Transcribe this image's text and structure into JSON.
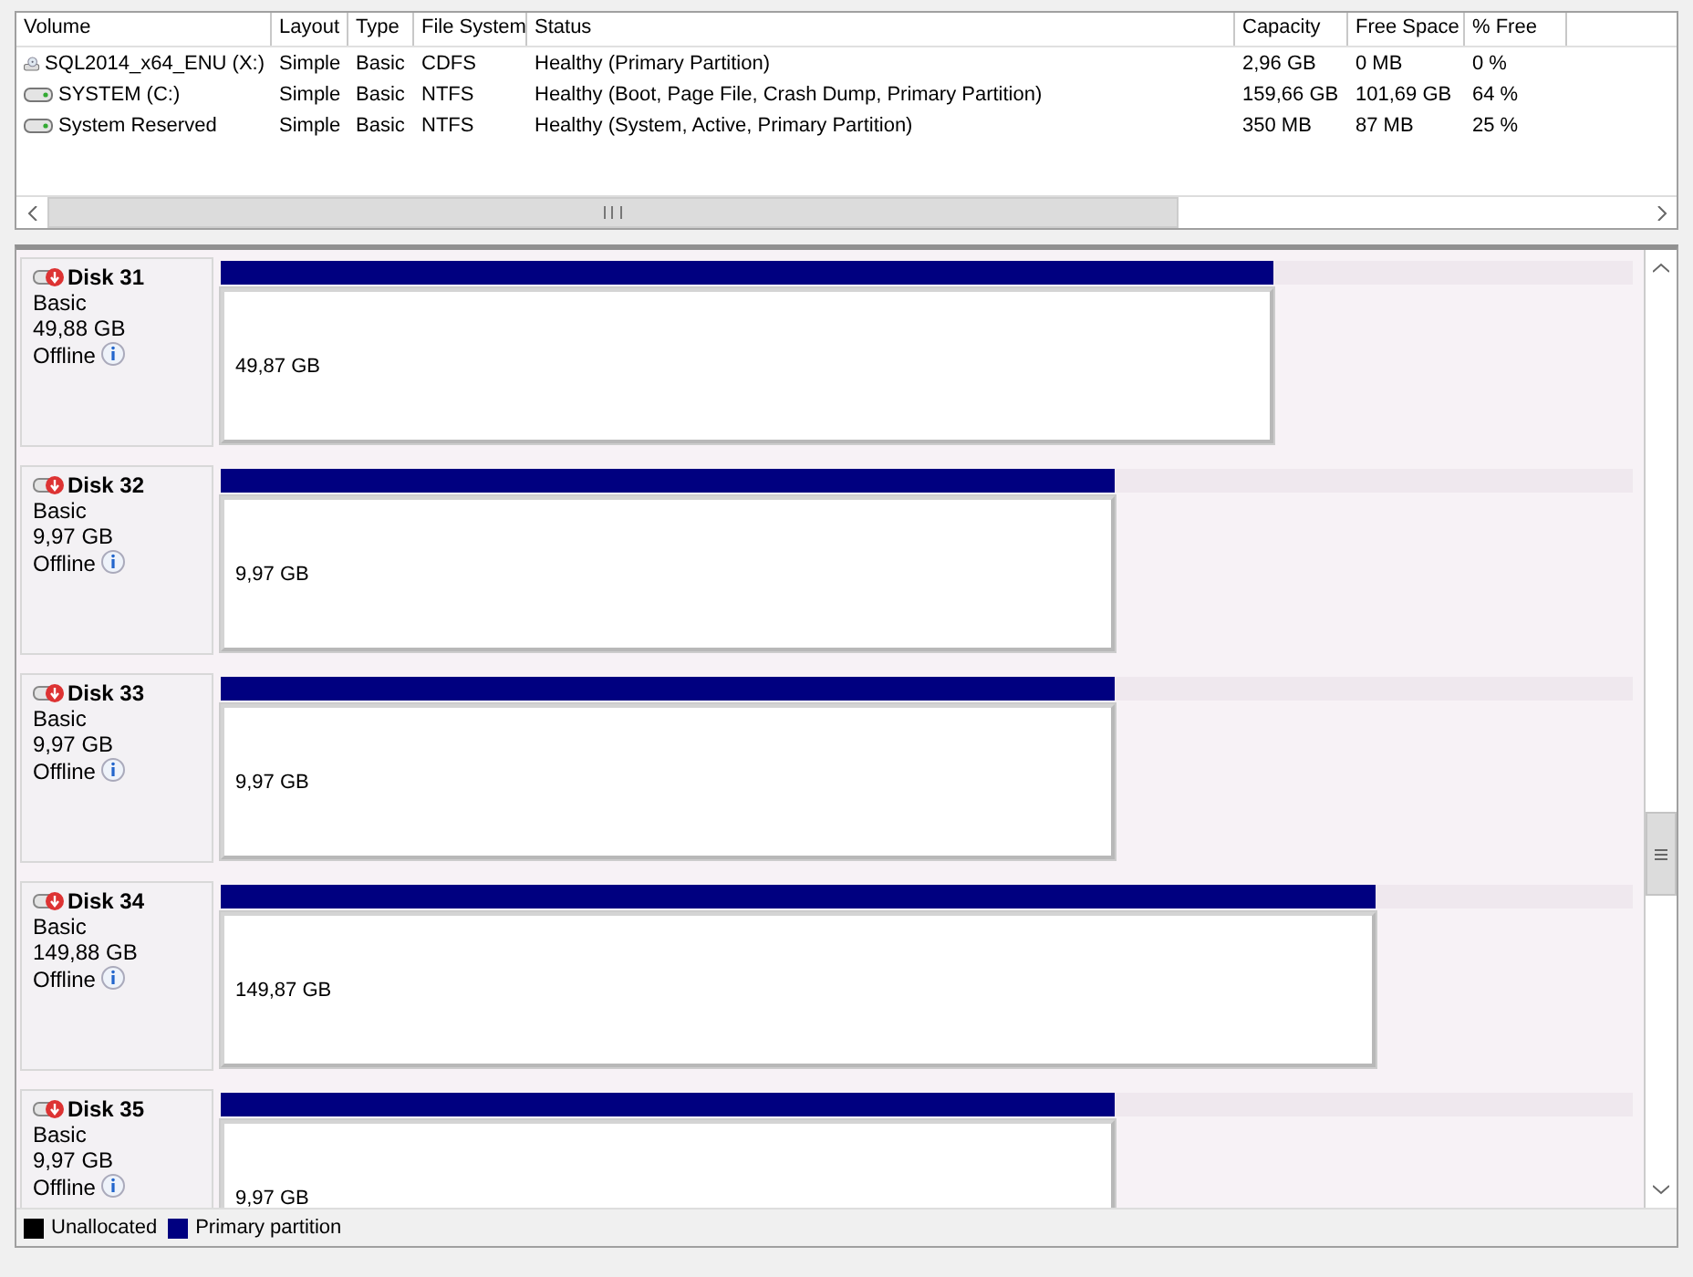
{
  "volumes": {
    "columns": [
      "Volume",
      "Layout",
      "Type",
      "File System",
      "Status",
      "Capacity",
      "Free Space",
      "% Free"
    ],
    "rows": [
      {
        "kind": "optical",
        "cells": [
          "SQL2014_x64_ENU (X:)",
          "Simple",
          "Basic",
          "CDFS",
          "Healthy (Primary Partition)",
          "2,96 GB",
          "0 MB",
          "0 %"
        ]
      },
      {
        "kind": "disk",
        "cells": [
          "SYSTEM (C:)",
          "Simple",
          "Basic",
          "NTFS",
          "Healthy (Boot, Page File, Crash Dump, Primary Partition)",
          "159,66 GB",
          "101,69 GB",
          "64 %"
        ]
      },
      {
        "kind": "disk",
        "cells": [
          "System Reserved",
          "Simple",
          "Basic",
          "NTFS",
          "Healthy (System, Active, Primary Partition)",
          "350 MB",
          "87 MB",
          "25 %"
        ]
      }
    ]
  },
  "disks": [
    {
      "name": "Disk 31",
      "type": "Basic",
      "size": "49,88 GB",
      "status": "Offline",
      "partition": {
        "size": "49,87 GB",
        "level": 0.745
      }
    },
    {
      "name": "Disk 32",
      "type": "Basic",
      "size": "9,97 GB",
      "status": "Offline",
      "partition": {
        "size": "9,97 GB",
        "level": 0.633
      }
    },
    {
      "name": "Disk 33",
      "type": "Basic",
      "size": "9,97 GB",
      "status": "Offline",
      "partition": {
        "size": "9,97 GB",
        "level": 0.633
      }
    },
    {
      "name": "Disk 34",
      "type": "Basic",
      "size": "149,88 GB",
      "status": "Offline",
      "partition": {
        "size": "149,87 GB",
        "level": 0.818
      }
    },
    {
      "name": "Disk 35",
      "type": "Basic",
      "size": "9,97 GB",
      "status": "Offline",
      "partition": {
        "size": "9,97 GB",
        "level": 0.633
      }
    }
  ],
  "legend": [
    {
      "label": "Unallocated",
      "color": "#000000"
    },
    {
      "label": "Primary partition",
      "color": "#000080"
    }
  ]
}
